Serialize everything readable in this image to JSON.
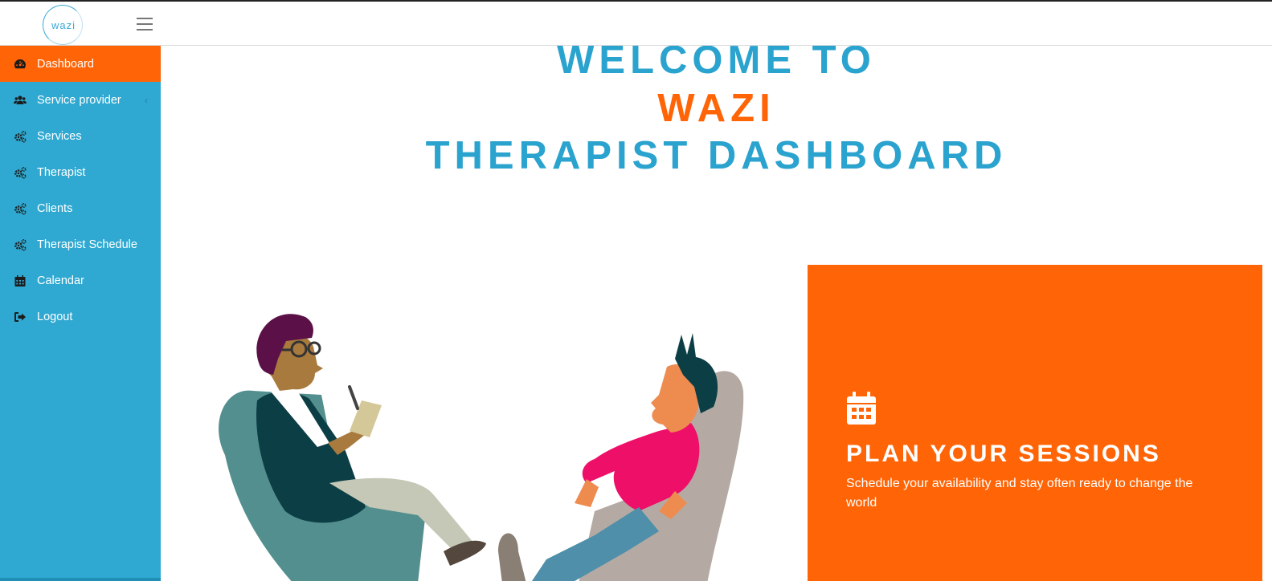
{
  "brand": {
    "logo_text": "wazi"
  },
  "sidebar": {
    "items": [
      {
        "label": "Dashboard",
        "icon": "dashboard-icon"
      },
      {
        "label": "Service provider",
        "icon": "users-icon",
        "caret": "‹"
      },
      {
        "label": "Services",
        "icon": "cogs-icon"
      },
      {
        "label": "Therapist",
        "icon": "cogs-icon"
      },
      {
        "label": "Clients",
        "icon": "cogs-icon"
      },
      {
        "label": "Therapist Schedule",
        "icon": "cogs-icon"
      },
      {
        "label": "Calendar",
        "icon": "calendar-icon"
      },
      {
        "label": "Logout",
        "icon": "logout-icon"
      }
    ],
    "active_index": 0
  },
  "main": {
    "headline_line1": "WELCOME TO",
    "headline_line2": "WAZI",
    "headline_line3": "THERAPIST DASHBOARD"
  },
  "promo": {
    "icon": "calendar-icon",
    "title": "PLAN YOUR SESSIONS",
    "description": "Schedule your availability and stay often ready to change the world"
  },
  "colors": {
    "brand_blue": "#2fa9d1",
    "accent_orange": "#ff6406",
    "white": "#ffffff"
  }
}
